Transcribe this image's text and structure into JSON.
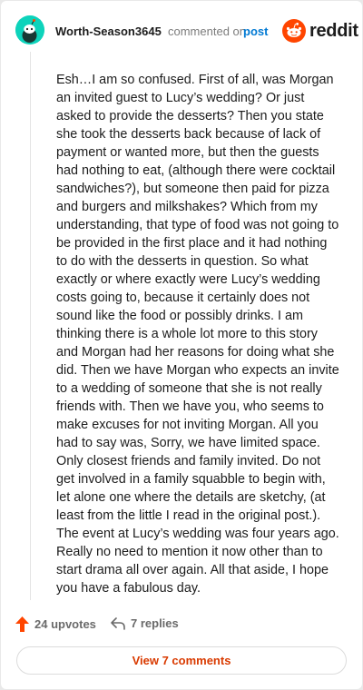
{
  "header": {
    "username": "Worth-Season3645",
    "commented_text": "commented on",
    "post_link": "post",
    "brand": "reddit",
    "avatar_icon": "snoo-avatar-icon",
    "brand_icon": "reddit-logo-icon"
  },
  "comment": {
    "body": "Esh…I am so confused. First of all, was Morgan an invited guest to Lucy’s wedding? Or just asked to provide the desserts? Then you state she took the desserts back because of lack of payment or wanted more, but then the guests had nothing to eat, (although there were cocktail sandwiches?), but someone then paid for pizza and burgers and milkshakes? Which from my understanding, that type of food was not going to be provided in the first place and it had nothing to do with the desserts in question. So what exactly or where exactly were Lucy’s wedding costs going to, because it certainly does not sound like the food or possibly drinks. I am thinking there is a whole lot more to this story and Morgan had her reasons for doing what she did. Then we have Morgan who expects an invite to a wedding of someone that she is not really friends with. Then we have you, who seems to make excuses for not inviting Morgan. All you had to say was, Sorry, we have limited space. Only closest friends and family invited. Do not get involved in a family squabble to begin with, let alone one where the details are sketchy, (at least from the little I read in the original post.). The event at Lucy’s wedding was four years ago. Really no need to mention it now other than to start drama all over again. All that aside, I hope you have a fabulous day."
  },
  "actions": {
    "upvotes": "24 upvotes",
    "replies": "7 replies",
    "view_comments": "View 7 comments"
  },
  "colors": {
    "accent": "#ff4500",
    "link": "#0079d3",
    "avatar_bg": "#0dd3bb",
    "view_button_text": "#d93a00"
  }
}
